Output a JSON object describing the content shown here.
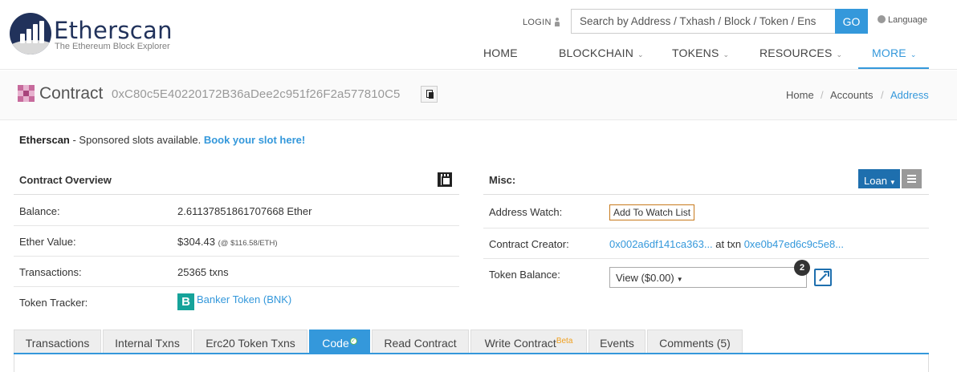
{
  "header": {
    "brand": "Etherscan",
    "tagline": "The Ethereum Block Explorer",
    "login_label": "LOGIN",
    "search_placeholder": "Search by Address / Txhash / Block / Token / Ens",
    "go_label": "GO",
    "language_label": "Language",
    "nav": [
      {
        "label": "HOME",
        "has_dropdown": false
      },
      {
        "label": "BLOCKCHAIN",
        "has_dropdown": true
      },
      {
        "label": "TOKENS",
        "has_dropdown": true
      },
      {
        "label": "RESOURCES",
        "has_dropdown": true
      },
      {
        "label": "MORE",
        "has_dropdown": true,
        "active": true
      }
    ]
  },
  "title_bar": {
    "title": "Contract",
    "address": "0xC80c5E40220172B36aDee2c951f26F2a577810C5",
    "breadcrumb": [
      "Home",
      "Accounts",
      "Address"
    ]
  },
  "sponsor": {
    "brand": "Etherscan",
    "text": " - Sponsored slots available. ",
    "link": "Book your slot here!"
  },
  "overview": {
    "heading": "Contract Overview",
    "rows": [
      {
        "label": "Balance:",
        "value": "2.61137851861707668 Ether"
      },
      {
        "label": "Ether Value:",
        "value": "$304.43",
        "note": "(@ $116.58/ETH)"
      },
      {
        "label": "Transactions:",
        "value": "25365 txns"
      },
      {
        "label": "Token Tracker:",
        "value": "Banker Token (BNK)",
        "icon_letter": "B"
      }
    ]
  },
  "misc": {
    "heading": "Misc:",
    "loan_label": "Loan",
    "address_watch_label": "Address Watch:",
    "watch_button": "Add To Watch List",
    "creator_label": "Contract Creator:",
    "creator_address": "0x002a6df141ca363...",
    "creator_at": " at txn ",
    "creator_txn": "0xe0b47ed6c9c5e8...",
    "token_balance_label": "Token Balance:",
    "token_view": "View ($0.00)",
    "token_count": "2"
  },
  "tabs": [
    {
      "label": "Transactions"
    },
    {
      "label": "Internal Txns"
    },
    {
      "label": "Erc20 Token Txns"
    },
    {
      "label": "Code",
      "active": true,
      "verified": true
    },
    {
      "label": "Read Contract"
    },
    {
      "label": "Write Contract",
      "sup": "Beta"
    },
    {
      "label": "Events"
    },
    {
      "label": "Comments (5)"
    }
  ],
  "colors": {
    "accent": "#3498db",
    "brand_navy": "#21325b",
    "loan_button": "#1e6fae",
    "token_icon": "#16a39a",
    "watch_border": "#c77a1d"
  }
}
